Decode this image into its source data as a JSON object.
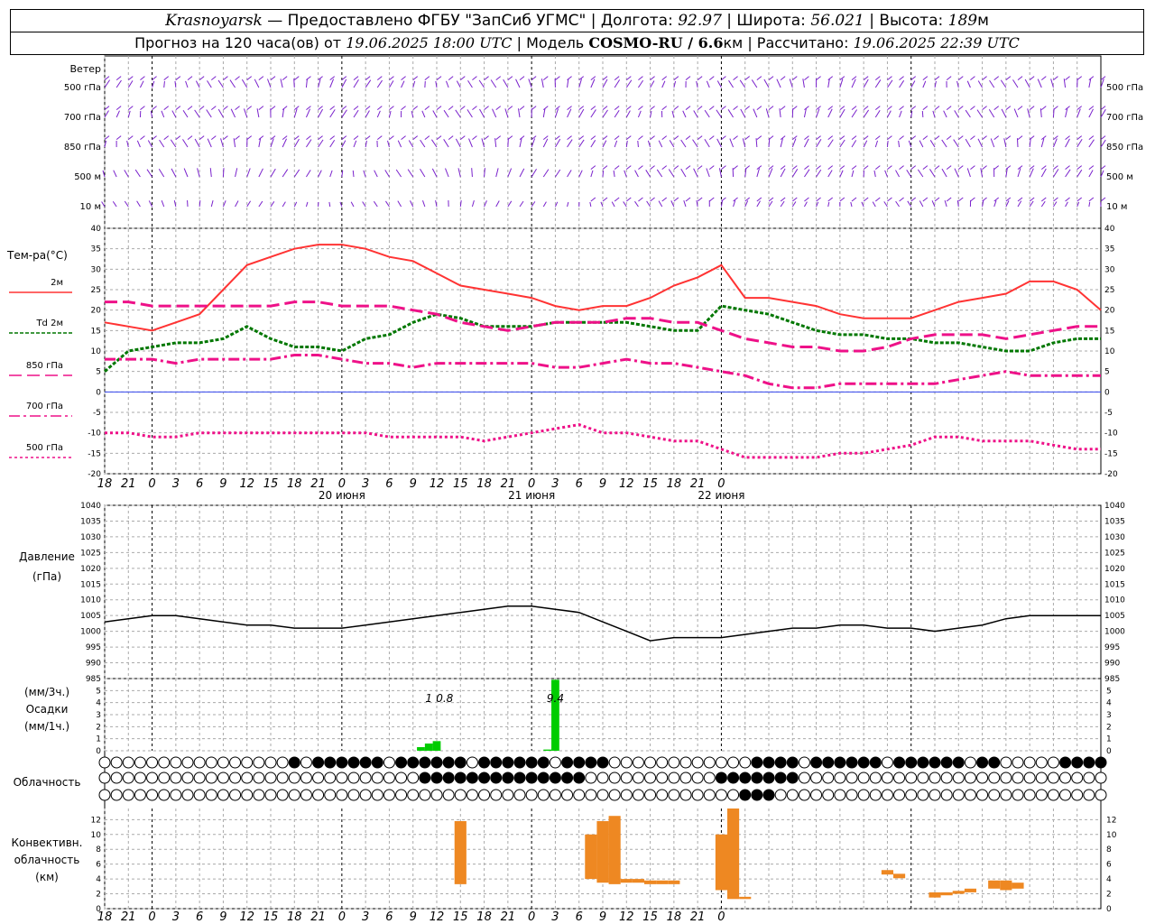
{
  "header": {
    "city": "Krasnoyarsk",
    "provider": "— Предоставлено ФГБУ \"ЗапСиб УГМС\" | Долгота:",
    "lon": "92.97",
    "lat_label": "| Широта:",
    "lat": "56.021",
    "alt_label": "| Высота:",
    "alt": "189",
    "alt_unit": "м",
    "line2_a": "Прогноз на 120 часа(ов) от",
    "start": "19.06.2025 18:00 UTC",
    "line2_b": "| Модель",
    "model": "COSMO-RU / 6.6",
    "model_unit": "км | Рассчитано:",
    "computed": "19.06.2025 22:39 UTC"
  },
  "labels": {
    "wind": "Ветер",
    "wind_levels": [
      "500 гПа",
      "700 гПа",
      "850 гПа",
      "500 м",
      "10 м"
    ],
    "temp_title": "Тем-ра(°C)",
    "temp_legend": [
      "2м",
      "Td 2м",
      "850 гПа",
      "700 гПа",
      "500 гПа"
    ],
    "pressure": [
      "Давление",
      "(гПа)"
    ],
    "precip": [
      "(мм/3ч.)",
      "Осадки",
      "(мм/1ч.)"
    ],
    "cloud": "Облачность",
    "conv": [
      "Конвективн.",
      "облачность",
      "(км)"
    ],
    "x_ticks": [
      "18",
      "21",
      "0",
      "3",
      "6",
      "9",
      "12",
      "15",
      "18",
      "21",
      "0",
      "3",
      "6",
      "9",
      "12",
      "15",
      "18",
      "21",
      "0",
      "3",
      "6",
      "9",
      "12",
      "15",
      "18",
      "21",
      "0"
    ],
    "dates": [
      "20 июня",
      "21 июня",
      "22 июня"
    ]
  },
  "colors": {
    "t2m": "#ff3333",
    "td": "#007700",
    "t850": "#ee1188",
    "t700": "#ee1188",
    "t500": "#ee1188",
    "wind": "#7a22cc",
    "precip": "#00cc00",
    "conv": "#ee8822",
    "zero": "#3344ee"
  },
  "chart_data": [
    {
      "type": "line",
      "title": "Тем-ра(°C)",
      "x_hours": [
        0,
        3,
        6,
        9,
        12,
        15,
        18,
        21,
        24,
        27,
        30,
        33,
        36,
        39,
        42,
        45,
        48,
        51,
        54,
        57,
        60,
        63,
        66,
        69,
        72,
        75,
        78,
        81,
        84,
        87,
        90,
        93,
        96,
        99,
        102,
        105,
        108,
        111,
        114,
        117,
        120,
        123,
        126
      ],
      "ylim": [
        -20,
        40
      ],
      "series": [
        {
          "name": "2м",
          "values": [
            17,
            16,
            15,
            17,
            19,
            25,
            31,
            33,
            35,
            36,
            36,
            35,
            33,
            32,
            29,
            26,
            25,
            24,
            23,
            21,
            20,
            21,
            21,
            23,
            26,
            28,
            31,
            23,
            23,
            22,
            21,
            19,
            18,
            18,
            18,
            20,
            22,
            23,
            24,
            27,
            27,
            25,
            20
          ]
        },
        {
          "name": "Td 2м",
          "values": [
            5,
            10,
            11,
            12,
            12,
            13,
            16,
            13,
            11,
            11,
            10,
            13,
            14,
            17,
            19,
            18,
            16,
            16,
            16,
            17,
            17,
            17,
            17,
            16,
            15,
            15,
            21,
            20,
            19,
            17,
            15,
            14,
            14,
            13,
            13,
            12,
            12,
            11,
            10,
            10,
            12,
            13,
            13
          ]
        },
        {
          "name": "850 гПа",
          "values": [
            22,
            22,
            21,
            21,
            21,
            21,
            21,
            21,
            22,
            22,
            21,
            21,
            21,
            20,
            19,
            17,
            16,
            15,
            16,
            17,
            17,
            17,
            18,
            18,
            17,
            17,
            15,
            13,
            12,
            11,
            11,
            10,
            10,
            11,
            13,
            14,
            14,
            14,
            13,
            14,
            15,
            16,
            16
          ]
        },
        {
          "name": "700 гПа",
          "values": [
            8,
            8,
            8,
            7,
            8,
            8,
            8,
            8,
            9,
            9,
            8,
            7,
            7,
            6,
            7,
            7,
            7,
            7,
            7,
            6,
            6,
            7,
            8,
            7,
            7,
            6,
            5,
            4,
            2,
            1,
            1,
            2,
            2,
            2,
            2,
            2,
            3,
            4,
            5,
            4,
            4,
            4,
            4
          ]
        },
        {
          "name": "500 гПа",
          "values": [
            -10,
            -10,
            -11,
            -11,
            -10,
            -10,
            -10,
            -10,
            -10,
            -10,
            -10,
            -10,
            -11,
            -11,
            -11,
            -11,
            -12,
            -11,
            -10,
            -9,
            -8,
            -10,
            -10,
            -11,
            -12,
            -12,
            -14,
            -16,
            -16,
            -16,
            -16,
            -15,
            -15,
            -14,
            -13,
            -11,
            -11,
            -12,
            -12,
            -12,
            -13,
            -14,
            -14
          ]
        }
      ]
    },
    {
      "type": "line",
      "title": "Давление (гПа)",
      "x_hours": [
        0,
        3,
        6,
        9,
        12,
        15,
        18,
        21,
        24,
        27,
        30,
        33,
        36,
        39,
        42,
        45,
        48,
        51,
        54,
        57,
        60,
        63,
        66,
        69,
        72,
        75,
        78,
        81,
        84,
        87,
        90,
        93,
        96,
        99,
        102,
        105,
        108,
        111,
        114,
        117,
        120,
        123,
        126
      ],
      "ylim": [
        985,
        1040
      ],
      "series": [
        {
          "name": "Давление",
          "values": [
            1003,
            1004,
            1005,
            1005,
            1004,
            1003,
            1002,
            1002,
            1001,
            1001,
            1001,
            1002,
            1003,
            1004,
            1005,
            1006,
            1007,
            1008,
            1008,
            1007,
            1006,
            1003,
            1000,
            997,
            998,
            998,
            998,
            999,
            1000,
            1001,
            1001,
            1002,
            1002,
            1001,
            1001,
            1000,
            1001,
            1002,
            1004,
            1005,
            1005,
            1005,
            1005
          ]
        }
      ]
    },
    {
      "type": "bar",
      "title": "Осадки (мм/3ч.) (мм/1ч.)",
      "ylim": [
        0,
        6
      ],
      "bars": [
        {
          "x_hour": 40,
          "value": 0.3
        },
        {
          "x_hour": 41,
          "value": 0.6
        },
        {
          "x_hour": 42,
          "value": 0.8
        },
        {
          "x_hour": 56,
          "value": 0.1
        },
        {
          "x_hour": 57,
          "value": 5.9
        }
      ],
      "annotations": [
        {
          "x_hour": 41,
          "text": "1"
        },
        {
          "x_hour": 43,
          "text": "0.8"
        },
        {
          "x_hour": 57,
          "text": "9.4"
        }
      ]
    },
    {
      "type": "bar",
      "title": "Конвективн. облачность (км)",
      "ylim": [
        0,
        13
      ],
      "bars": [
        {
          "x_hour": 30,
          "bottom": 3.3,
          "top": 11.8
        },
        {
          "x_hour": 41,
          "bottom": 4,
          "top": 10
        },
        {
          "x_hour": 42,
          "bottom": 3.5,
          "top": 11.8
        },
        {
          "x_hour": 43,
          "bottom": 3.3,
          "top": 12.5
        },
        {
          "x_hour": 44,
          "bottom": 3.5,
          "top": 4
        },
        {
          "x_hour": 45,
          "bottom": 3.5,
          "top": 4
        },
        {
          "x_hour": 46,
          "bottom": 3.3,
          "top": 3.8
        },
        {
          "x_hour": 47,
          "bottom": 3.3,
          "top": 3.8
        },
        {
          "x_hour": 48,
          "bottom": 3.3,
          "top": 3.8
        },
        {
          "x_hour": 52,
          "bottom": 2.5,
          "top": 10
        },
        {
          "x_hour": 53,
          "bottom": 1.3,
          "top": 13.5
        },
        {
          "x_hour": 54,
          "bottom": 1.3,
          "top": 1.6
        },
        {
          "x_hour": 66,
          "bottom": 4.6,
          "top": 5.2
        },
        {
          "x_hour": 67,
          "bottom": 4.1,
          "top": 4.7
        },
        {
          "x_hour": 70,
          "bottom": 1.5,
          "top": 2.2
        },
        {
          "x_hour": 71,
          "bottom": 1.8,
          "top": 2.2
        },
        {
          "x_hour": 72,
          "bottom": 2,
          "top": 2.4
        },
        {
          "x_hour": 73,
          "bottom": 2.2,
          "top": 2.7
        },
        {
          "x_hour": 75,
          "bottom": 2.7,
          "top": 3.8
        },
        {
          "x_hour": 76,
          "bottom": 2.5,
          "top": 3.8
        },
        {
          "x_hour": 77,
          "bottom": 2.7,
          "top": 3.5
        }
      ]
    }
  ]
}
